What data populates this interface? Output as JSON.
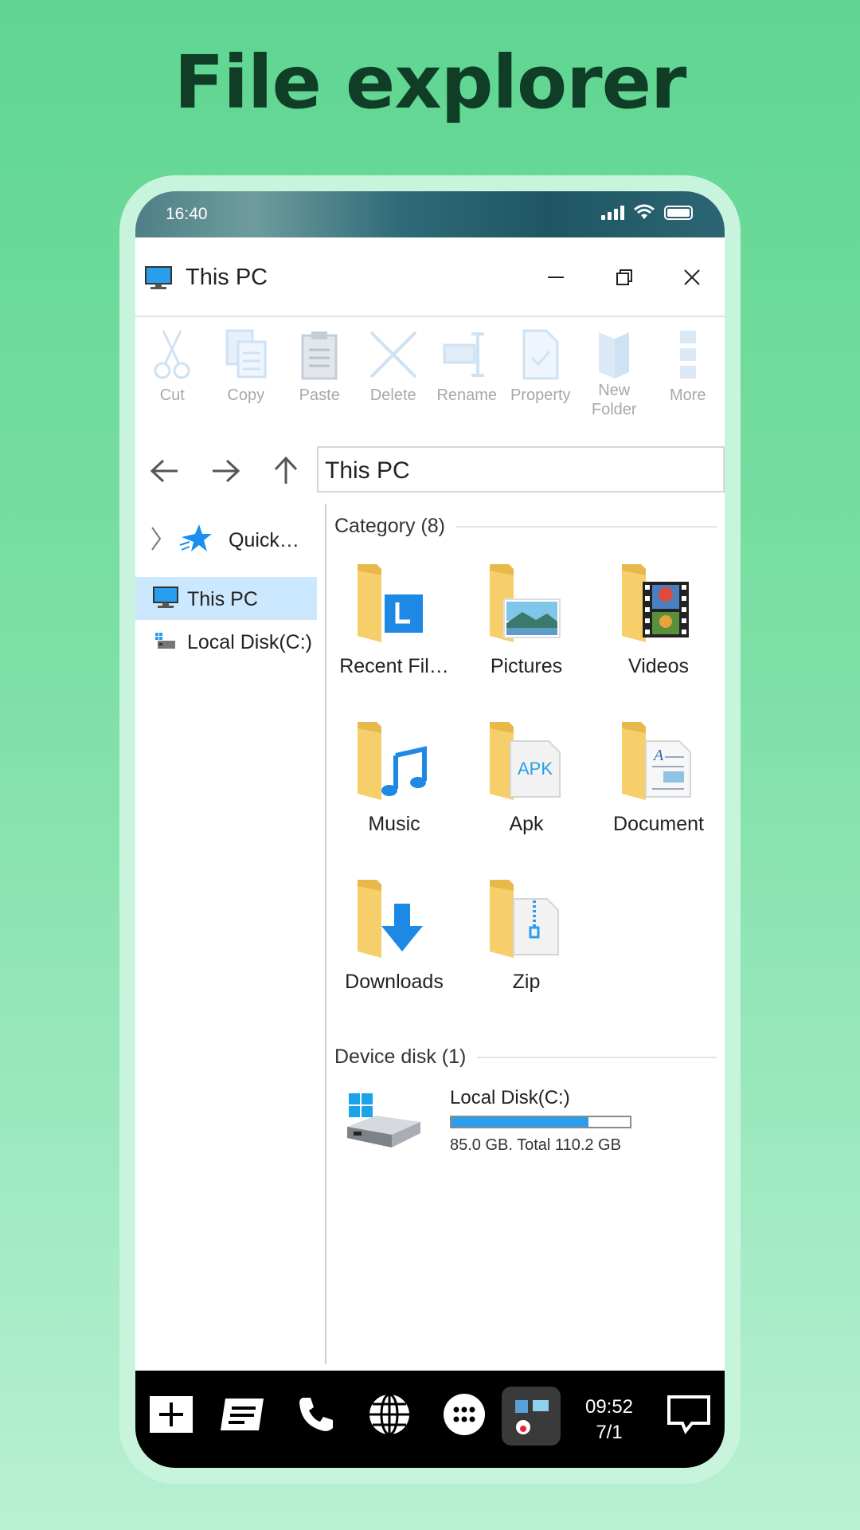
{
  "promo": {
    "title": "File explorer"
  },
  "status_bar": {
    "time": "16:40"
  },
  "window": {
    "title": "This PC",
    "title_icon": "pc-icon"
  },
  "toolbar": {
    "items": [
      {
        "label": "Cut",
        "icon": "scissors-icon"
      },
      {
        "label": "Copy",
        "icon": "copy-icon"
      },
      {
        "label": "Paste",
        "icon": "paste-icon"
      },
      {
        "label": "Delete",
        "icon": "delete-icon"
      },
      {
        "label": "Rename",
        "icon": "rename-icon"
      },
      {
        "label": "Property",
        "icon": "property-icon"
      },
      {
        "label": "New\nFolder",
        "icon": "new-folder-icon"
      },
      {
        "label": "More",
        "icon": "more-icon"
      }
    ]
  },
  "address_bar": {
    "path": "This PC"
  },
  "sidebar": {
    "items": [
      {
        "label": "Quick…",
        "icon": "star-icon"
      },
      {
        "label": "This PC",
        "icon": "pc-icon",
        "selected": true
      },
      {
        "label": "Local Disk(C:)",
        "icon": "disk-icon"
      }
    ]
  },
  "main": {
    "category_header": "Category (8)",
    "categories": [
      {
        "label": "Recent Fil…",
        "icon": "recent-folder-icon"
      },
      {
        "label": "Pictures",
        "icon": "pictures-folder-icon"
      },
      {
        "label": "Videos",
        "icon": "videos-folder-icon"
      },
      {
        "label": "Music",
        "icon": "music-folder-icon"
      },
      {
        "label": "Apk",
        "icon": "apk-folder-icon",
        "badge": "APK"
      },
      {
        "label": "Document",
        "icon": "document-folder-icon"
      },
      {
        "label": "Downloads",
        "icon": "downloads-folder-icon"
      },
      {
        "label": "Zip",
        "icon": "zip-folder-icon"
      }
    ],
    "device_header": "Device disk (1)",
    "disk": {
      "name": "Local Disk(C:)",
      "info": "85.0 GB. Total 110.2 GB",
      "used_fraction": 0.77
    }
  },
  "taskbar": {
    "time": "09:52",
    "date": "7/1",
    "items": [
      "add-icon",
      "notes-icon",
      "phone-icon",
      "globe-icon",
      "apps-icon",
      "recent-apps-icon",
      "chat-icon"
    ]
  },
  "colors": {
    "accent": "#2a9ded",
    "folder": "#f6cf6a",
    "selection": "#cce8ff",
    "background": "#5fd591"
  }
}
